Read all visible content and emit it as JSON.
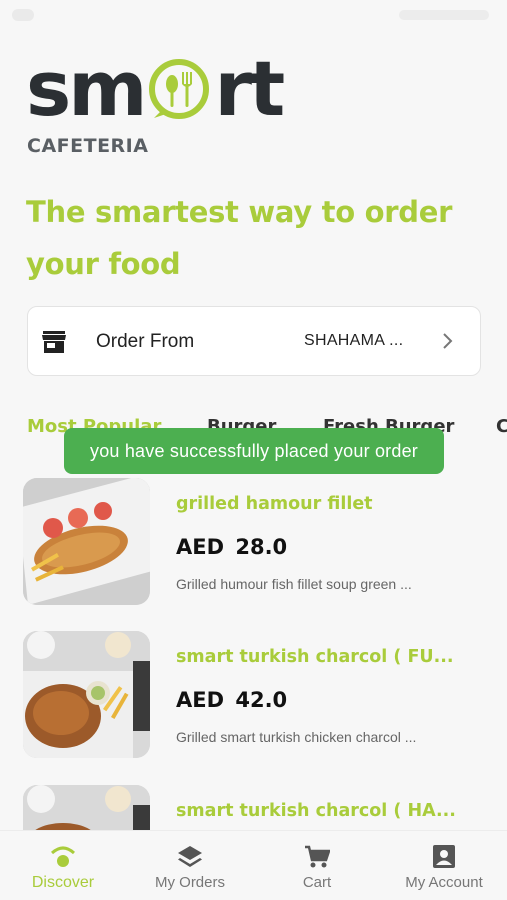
{
  "logo": {
    "word_start": "sm",
    "word_end": "rt",
    "subtitle": "CAFETERIA"
  },
  "headline": "The smartest way to order your food",
  "order": {
    "label": "Order From",
    "value": "SHAHAMA ..."
  },
  "tabs": [
    {
      "label": "Most Popular"
    },
    {
      "label": "Burger"
    },
    {
      "label": "Fresh Burger"
    },
    {
      "label": "C"
    }
  ],
  "toast": "you have successfully placed your order",
  "items": [
    {
      "name": "grilled hamour fillet",
      "price": "AED  28.0",
      "desc": "Grilled humour fish fillet soup green ..."
    },
    {
      "name": "smart turkish charcol ( FU...",
      "price": "AED  42.0",
      "desc": "Grilled smart turkish chicken charcol ..."
    },
    {
      "name": "smart turkish charcol ( HA..."
    }
  ],
  "nav": [
    {
      "label": "Discover",
      "icon": "discover-icon"
    },
    {
      "label": "My Orders",
      "icon": "layers-icon"
    },
    {
      "label": "Cart",
      "icon": "cart-icon"
    },
    {
      "label": "My Account",
      "icon": "account-icon"
    }
  ],
  "colors": {
    "accent": "#a9cc3b",
    "toast": "#4caf50",
    "logo_dark": "#2b2f33"
  }
}
